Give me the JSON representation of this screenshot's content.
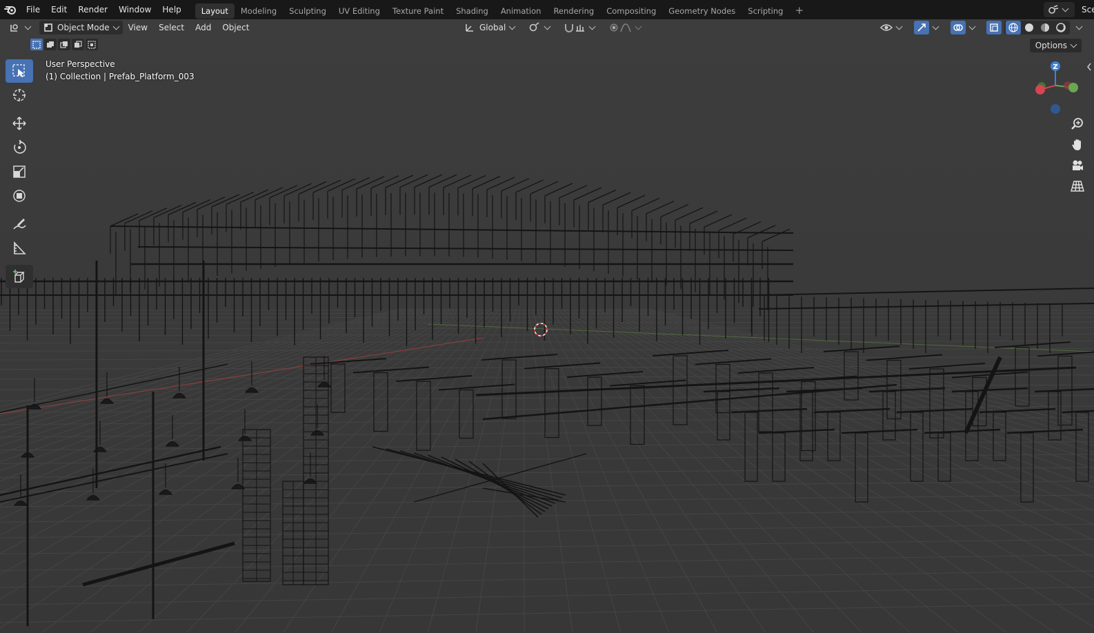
{
  "topbar": {
    "logo_icon": "blender-logo-icon",
    "menus": [
      {
        "label": "File"
      },
      {
        "label": "Edit"
      },
      {
        "label": "Render"
      },
      {
        "label": "Window"
      },
      {
        "label": "Help"
      }
    ],
    "workspaces": [
      {
        "label": "Layout",
        "active": true
      },
      {
        "label": "Modeling"
      },
      {
        "label": "Sculpting"
      },
      {
        "label": "UV Editing"
      },
      {
        "label": "Texture Paint"
      },
      {
        "label": "Shading"
      },
      {
        "label": "Animation"
      },
      {
        "label": "Rendering"
      },
      {
        "label": "Compositing"
      },
      {
        "label": "Geometry Nodes"
      },
      {
        "label": "Scripting"
      }
    ],
    "add_workspace": "+",
    "scene_label": "Scen"
  },
  "viewport_header": {
    "mode_label": "Object Mode",
    "menus": [
      {
        "label": "View"
      },
      {
        "label": "Select"
      },
      {
        "label": "Add"
      },
      {
        "label": "Object"
      }
    ],
    "transform_orientation": "Global",
    "options_label": "Options"
  },
  "viewport_info": {
    "perspective": "User Perspective",
    "collection": "(1) Collection | Prefab_Platform_003"
  },
  "gizmo": {
    "z_label": "Z",
    "axis_colors": {
      "x": "#d64550",
      "y": "#6aa84f",
      "z": "#3f83d8"
    }
  },
  "toolbar": {
    "tools": [
      "select-box-icon",
      "cursor-icon",
      "move-icon",
      "rotate-icon",
      "scale-icon",
      "transform-icon",
      "annotate-icon",
      "measure-icon",
      "add-cube-icon"
    ]
  },
  "colors": {
    "active_blue": "#4772b3",
    "grid_bg": "#3a3a3a",
    "wire": "#141414"
  }
}
